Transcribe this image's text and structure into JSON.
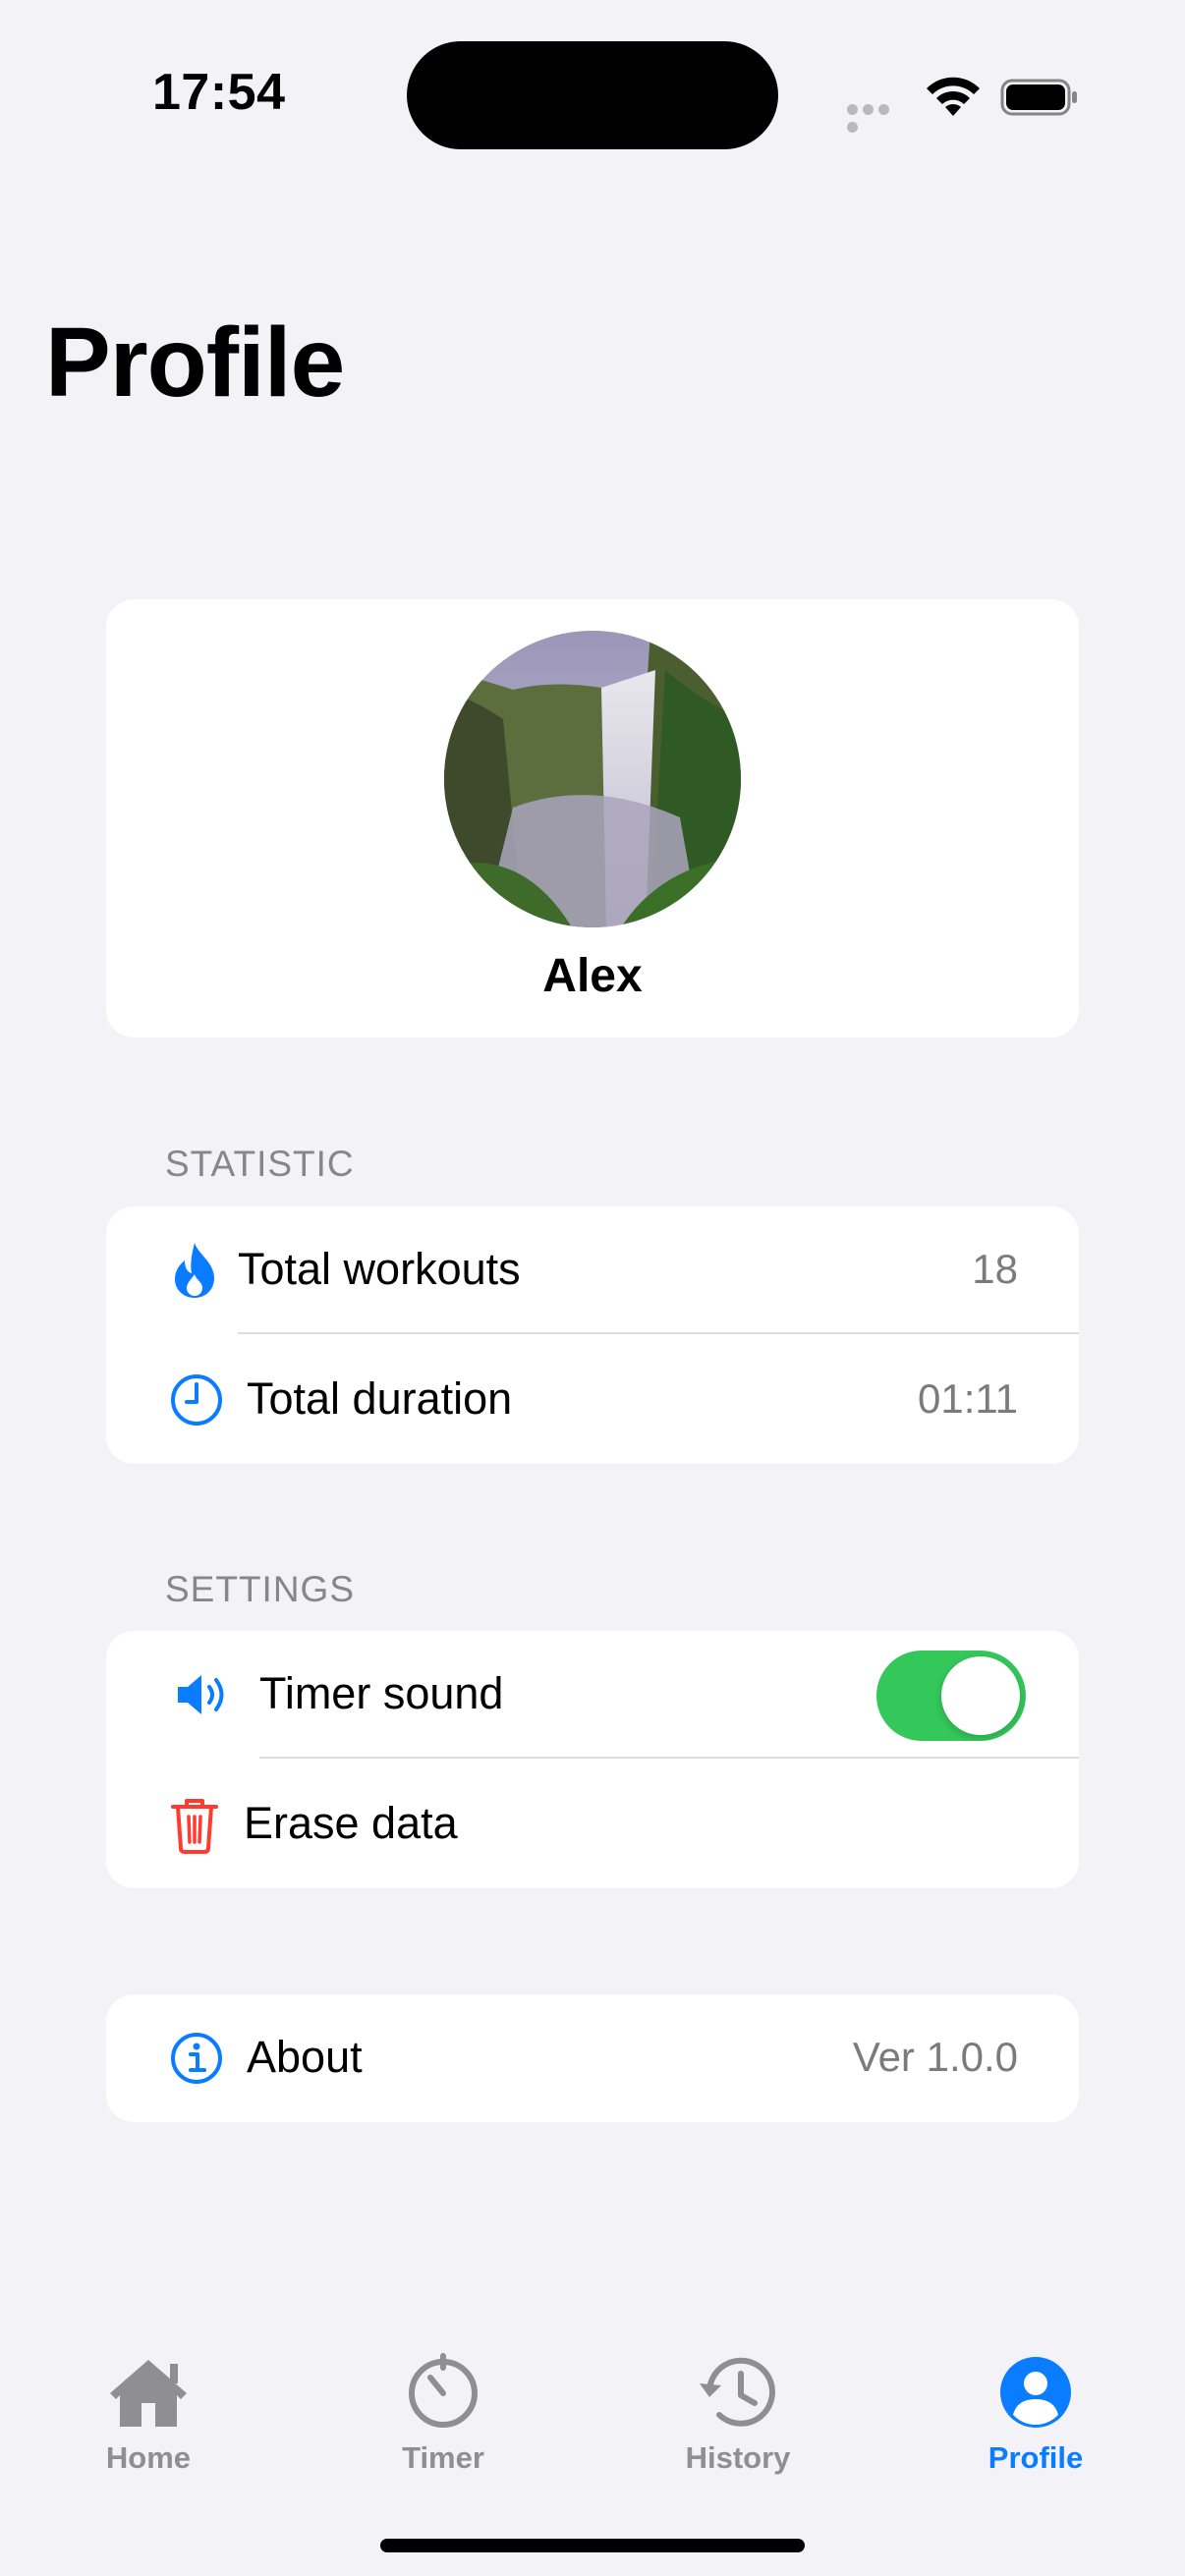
{
  "status_bar": {
    "time": "17:54"
  },
  "page": {
    "title": "Profile"
  },
  "profile": {
    "name": "Alex",
    "avatar_icon": "waterfall-photo"
  },
  "statistic": {
    "header": "STATISTIC",
    "rows": [
      {
        "icon": "flame-icon",
        "label": "Total workouts",
        "value": "18"
      },
      {
        "icon": "clock-icon",
        "label": "Total duration",
        "value": "01:11"
      }
    ]
  },
  "settings": {
    "header": "SETTINGS",
    "timer_sound": {
      "icon": "speaker-icon",
      "label": "Timer sound",
      "enabled": true
    },
    "erase": {
      "icon": "trash-icon",
      "label": "Erase data"
    }
  },
  "about": {
    "icon": "info-icon",
    "label": "About",
    "value": "Ver 1.0.0"
  },
  "tabs": [
    {
      "icon": "house-icon",
      "label": "Home",
      "active": false
    },
    {
      "icon": "timer-icon",
      "label": "Timer",
      "active": false
    },
    {
      "icon": "history-icon",
      "label": "History",
      "active": false
    },
    {
      "icon": "person-icon",
      "label": "Profile",
      "active": true
    }
  ],
  "colors": {
    "accent": "#0a7cff",
    "toggle_on": "#34c759",
    "destructive": "#ff3b30",
    "background": "#f2f2f7",
    "inactive_tab": "#8e8e93"
  }
}
